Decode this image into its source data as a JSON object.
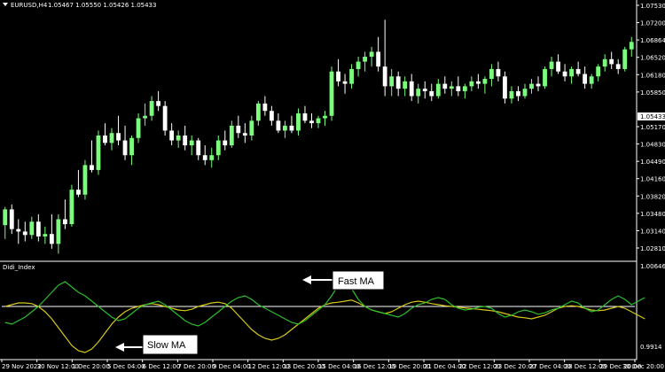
{
  "header": {
    "symbol_timeframe": "EURUSD,H4",
    "quotes": "1.05467 1.05550 1.05426 1.05433",
    "indicator_name": "Didi_Index"
  },
  "current_price": "1.05433",
  "colors": {
    "background": "#000000",
    "bull_candle": "#7CFC7C",
    "bear_candle": "#FFFFFF",
    "fast_ma": "#2DBE2D",
    "slow_ma": "#D7C81E",
    "baseline": "#FFFFFF",
    "axis": "#FFFFFF",
    "price_label_bg": "#FFFFFF"
  },
  "price_axis": [
    "1.07530",
    "1.07200",
    "1.06864",
    "1.06520",
    "1.06180",
    "1.05850",
    "1.05433",
    "1.05170",
    "1.04830",
    "1.04490",
    "1.04160",
    "1.03820",
    "1.03480",
    "1.03140",
    "1.02810"
  ],
  "indicator_axis": [
    "1.00646",
    "0.9914"
  ],
  "time_axis": [
    "29 Nov 2022",
    "30 Nov 12:00",
    "1 Dec 20:00",
    "5 Dec 04:00",
    "6 Dec 12:00",
    "7 Dec 20:00",
    "9 Dec 04:00",
    "12 Dec 12:00",
    "13 Dec 20:00",
    "15 Dec 04:00",
    "16 Dec 12:00",
    "19 Dec 20:00",
    "21 Dec 04:00",
    "22 Dec 12:00",
    "23 Dec 20:00",
    "27 Dec 04:00",
    "28 Dec 12:00",
    "29 Dec 20:00",
    "30 Dec 20:00"
  ],
  "callouts": {
    "fast": "Fast MA",
    "slow": "Slow MA"
  },
  "chart_data": {
    "type": "candlestick",
    "ylim": [
      1.027,
      1.077
    ],
    "candles": [
      [
        1.0338,
        1.0375,
        1.031,
        1.037
      ],
      [
        1.037,
        1.038,
        1.032,
        1.033
      ],
      [
        1.033,
        1.035,
        1.03,
        1.0325
      ],
      [
        1.0325,
        1.0345,
        1.0305,
        1.0318
      ],
      [
        1.0318,
        1.0355,
        1.031,
        1.0345
      ],
      [
        1.0345,
        1.036,
        1.0305,
        1.0315
      ],
      [
        1.0315,
        1.0335,
        1.03,
        1.032
      ],
      [
        1.032,
        1.036,
        1.029,
        1.03
      ],
      [
        1.03,
        1.036,
        1.028,
        1.035
      ],
      [
        1.035,
        1.039,
        1.033,
        1.034
      ],
      [
        1.034,
        1.042,
        1.0335,
        1.041
      ],
      [
        1.041,
        1.045,
        1.0395,
        1.04
      ],
      [
        1.04,
        1.047,
        1.039,
        1.046
      ],
      [
        1.046,
        1.051,
        1.0445,
        1.045
      ],
      [
        1.045,
        1.053,
        1.044,
        1.052
      ],
      [
        1.052,
        1.0545,
        1.05,
        1.0505
      ],
      [
        1.0505,
        1.0535,
        1.049,
        1.0525
      ],
      [
        1.0525,
        1.056,
        1.05,
        1.051
      ],
      [
        1.051,
        1.054,
        1.047,
        1.048
      ],
      [
        1.048,
        1.052,
        1.046,
        1.0515
      ],
      [
        1.0515,
        1.0565,
        1.0505,
        1.0555
      ],
      [
        1.0555,
        1.0585,
        1.054,
        1.056
      ],
      [
        1.056,
        1.06,
        1.055,
        1.059
      ],
      [
        1.059,
        1.061,
        1.057,
        1.058
      ],
      [
        1.058,
        1.059,
        1.052,
        1.053
      ],
      [
        1.053,
        1.0545,
        1.05,
        1.051
      ],
      [
        1.051,
        1.053,
        1.0495,
        1.052
      ],
      [
        1.052,
        1.054,
        1.049,
        1.05
      ],
      [
        1.05,
        1.052,
        1.048,
        1.051
      ],
      [
        1.051,
        1.0515,
        1.047,
        1.048
      ],
      [
        1.048,
        1.05,
        1.046,
        1.047
      ],
      [
        1.047,
        1.0495,
        1.0455,
        1.048
      ],
      [
        1.048,
        1.052,
        1.047,
        1.051
      ],
      [
        1.051,
        1.053,
        1.049,
        1.05
      ],
      [
        1.05,
        1.055,
        1.0495,
        1.054
      ],
      [
        1.054,
        1.056,
        1.0515,
        1.0525
      ],
      [
        1.0525,
        1.0545,
        1.0505,
        1.052
      ],
      [
        1.052,
        1.056,
        1.051,
        1.055
      ],
      [
        1.055,
        1.059,
        1.054,
        1.0585
      ],
      [
        1.0585,
        1.06,
        1.056,
        1.057
      ],
      [
        1.057,
        1.058,
        1.054,
        1.055
      ],
      [
        1.055,
        1.0565,
        1.0525,
        1.053
      ],
      [
        1.053,
        1.055,
        1.0515,
        1.054
      ],
      [
        1.054,
        1.056,
        1.0525,
        1.053
      ],
      [
        1.053,
        1.0575,
        1.052,
        1.0565
      ],
      [
        1.0565,
        1.058,
        1.0545,
        1.055
      ],
      [
        1.055,
        1.0565,
        1.0535,
        1.0545
      ],
      [
        1.0545,
        1.056,
        1.0535,
        1.0555
      ],
      [
        1.0555,
        1.057,
        1.054,
        1.056
      ],
      [
        1.056,
        1.066,
        1.055,
        1.065
      ],
      [
        1.065,
        1.0675,
        1.062,
        1.063
      ],
      [
        1.063,
        1.0645,
        1.0605,
        1.0625
      ],
      [
        1.0625,
        1.0665,
        1.0615,
        1.0655
      ],
      [
        1.0655,
        1.068,
        1.064,
        1.067
      ],
      [
        1.067,
        1.069,
        1.065,
        1.068
      ],
      [
        1.068,
        1.07,
        1.066,
        1.069
      ],
      [
        1.069,
        1.072,
        1.065,
        1.066
      ],
      [
        1.066,
        1.0755,
        1.06,
        1.062
      ],
      [
        1.062,
        1.0655,
        1.06,
        1.064
      ],
      [
        1.064,
        1.065,
        1.06,
        1.0615
      ],
      [
        1.0615,
        1.064,
        1.06,
        1.063
      ],
      [
        1.063,
        1.0645,
        1.059,
        1.06
      ],
      [
        1.06,
        1.0625,
        1.0585,
        1.0615
      ],
      [
        1.0615,
        1.063,
        1.0595,
        1.061
      ],
      [
        1.061,
        1.0625,
        1.059,
        1.06
      ],
      [
        1.06,
        1.0635,
        1.0595,
        1.0625
      ],
      [
        1.0625,
        1.064,
        1.0605,
        1.0615
      ],
      [
        1.0615,
        1.063,
        1.06,
        1.062
      ],
      [
        1.062,
        1.064,
        1.06,
        1.061
      ],
      [
        1.061,
        1.0625,
        1.0595,
        1.062
      ],
      [
        1.062,
        1.064,
        1.061,
        1.063
      ],
      [
        1.063,
        1.0645,
        1.0615,
        1.0625
      ],
      [
        1.0625,
        1.064,
        1.0605,
        1.0635
      ],
      [
        1.0635,
        1.0665,
        1.062,
        1.0655
      ],
      [
        1.0655,
        1.067,
        1.063,
        1.064
      ],
      [
        1.064,
        1.065,
        1.0585,
        1.0595
      ],
      [
        1.0595,
        1.062,
        1.0585,
        1.061
      ],
      [
        1.061,
        1.062,
        1.059,
        1.06
      ],
      [
        1.06,
        1.0625,
        1.0595,
        1.0615
      ],
      [
        1.0615,
        1.0635,
        1.0605,
        1.0625
      ],
      [
        1.0625,
        1.064,
        1.061,
        1.062
      ],
      [
        1.062,
        1.066,
        1.0615,
        1.0655
      ],
      [
        1.0655,
        1.068,
        1.064,
        1.067
      ],
      [
        1.067,
        1.0685,
        1.0645,
        1.065
      ],
      [
        1.065,
        1.0665,
        1.063,
        1.064
      ],
      [
        1.064,
        1.066,
        1.0625,
        1.0655
      ],
      [
        1.0655,
        1.067,
        1.064,
        1.0645
      ],
      [
        1.0645,
        1.066,
        1.0615,
        1.0625
      ],
      [
        1.0625,
        1.0645,
        1.0615,
        1.064
      ],
      [
        1.064,
        1.0665,
        1.063,
        1.066
      ],
      [
        1.066,
        1.0685,
        1.065,
        1.0675
      ],
      [
        1.0675,
        1.069,
        1.0655,
        1.0665
      ],
      [
        1.0665,
        1.0675,
        1.0645,
        1.0655
      ],
      [
        1.0655,
        1.07,
        1.065,
        1.0695
      ],
      [
        1.0695,
        1.072,
        1.068,
        1.071
      ]
    ],
    "fast_ma": [
      0.9955,
      0.995,
      0.996,
      0.997,
      0.9985,
      1.0,
      1.002,
      1.004,
      1.006,
      1.007,
      1.0055,
      1.004,
      1.003,
      1.0015,
      1.0,
      0.9985,
      0.997,
      0.996,
      0.9965,
      0.998,
      0.9995,
      1.0005,
      1.001,
      1.0015,
      1.0005,
      0.999,
      0.9975,
      0.996,
      0.995,
      0.9945,
      0.9955,
      0.997,
      0.9985,
      1.0,
      1.0015,
      1.0025,
      1.003,
      1.002,
      1.0005,
      0.9995,
      0.9985,
      0.9975,
      0.9965,
      0.9955,
      0.995,
      0.996,
      0.9975,
      0.999,
      1.0005,
      1.003,
      1.006,
      1.008,
      1.005,
      1.002,
      1.0,
      0.999,
      0.9985,
      0.998,
      0.9975,
      0.997,
      0.998,
      0.9995,
      1.0005,
      1.001,
      1.002,
      1.0025,
      1.002,
      1.0005,
      0.9995,
      0.999,
      0.9992,
      0.9998,
      1.0,
      0.9995,
      0.998,
      0.997,
      0.9975,
      0.9985,
      0.999,
      0.9985,
      0.9978,
      0.9982,
      0.999,
      0.9995,
      1.0005,
      1.0015,
      1.001,
      0.9995,
      0.9985,
      0.999,
      1.0005,
      1.002,
      1.003,
      1.002,
      1.0005,
      1.0015,
      1.0025
    ],
    "slow_ma": [
      1.0,
      1.0005,
      1.001,
      1.001,
      1.0008,
      1.0,
      0.9985,
      0.9965,
      0.994,
      0.9915,
      0.989,
      0.9875,
      0.987,
      0.988,
      0.99,
      0.9925,
      0.995,
      0.997,
      0.9985,
      0.9995,
      1.0,
      1.0005,
      1.0008,
      1.0005,
      1.0,
      0.9995,
      0.999,
      0.9988,
      0.9992,
      1.0,
      1.0005,
      1.001,
      1.0012,
      1.0008,
      0.9995,
      0.9975,
      0.9955,
      0.9935,
      0.992,
      0.991,
      0.9905,
      0.991,
      0.992,
      0.9935,
      0.995,
      0.9965,
      0.998,
      0.9995,
      1.0005,
      1.001,
      1.0012,
      1.0015,
      1.0018,
      1.001,
      1.0,
      0.999,
      0.9985,
      0.998,
      0.9985,
      0.9995,
      1.0005,
      1.0012,
      1.0015,
      1.0012,
      1.0008,
      1.0005,
      1.0002,
      1.0,
      0.9998,
      0.9996,
      0.9994,
      0.9992,
      0.999,
      0.9988,
      0.9985,
      0.998,
      0.9975,
      0.997,
      0.9968,
      0.9965,
      0.997,
      0.9975,
      0.9985,
      0.9995,
      1.0,
      1.0002,
      1.0,
      0.9995,
      0.999,
      0.9988,
      0.999,
      0.9995,
      1.0,
      0.9995,
      0.9985,
      0.9975,
      0.9965
    ],
    "indicator_ylim": [
      0.9855,
      1.0115
    ],
    "baseline": 1.0
  }
}
